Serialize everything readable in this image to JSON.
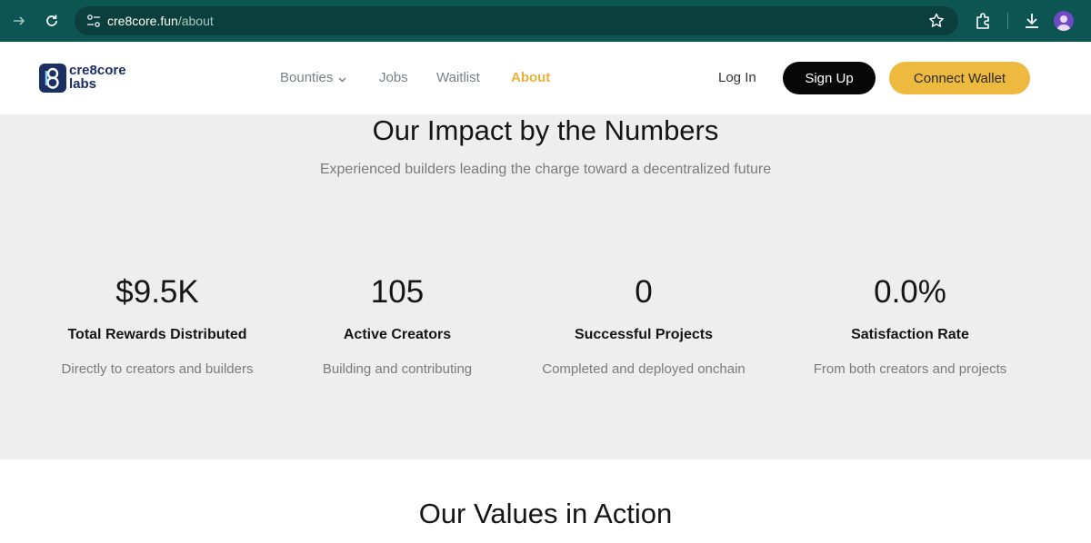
{
  "browser": {
    "url_domain": "cre8core.fun",
    "url_path": "/about"
  },
  "site": {
    "logo_line1": "cre8core",
    "logo_line2": "labs",
    "nav": [
      {
        "label": "Bounties"
      },
      {
        "label": "Jobs"
      },
      {
        "label": "Waitlist"
      },
      {
        "label": "About"
      }
    ],
    "login_label": "Log In",
    "signup_label": "Sign Up",
    "wallet_label": "Connect Wallet",
    "accent_color": "#edb93f"
  },
  "impact": {
    "title": "Our Impact by the Numbers",
    "subtitle": "Experienced builders leading the charge toward a decentralized future",
    "stats": [
      {
        "value": "$9.5K",
        "label": "Total Rewards Distributed",
        "desc": "Directly to creators and builders"
      },
      {
        "value": "105",
        "label": "Active Creators",
        "desc": "Building and contributing"
      },
      {
        "value": "0",
        "label": "Successful Projects",
        "desc": "Completed and deployed onchain"
      },
      {
        "value": "0.0%",
        "label": "Satisfaction Rate",
        "desc": "From both creators and projects"
      }
    ]
  },
  "values": {
    "title": "Our Values in Action"
  }
}
